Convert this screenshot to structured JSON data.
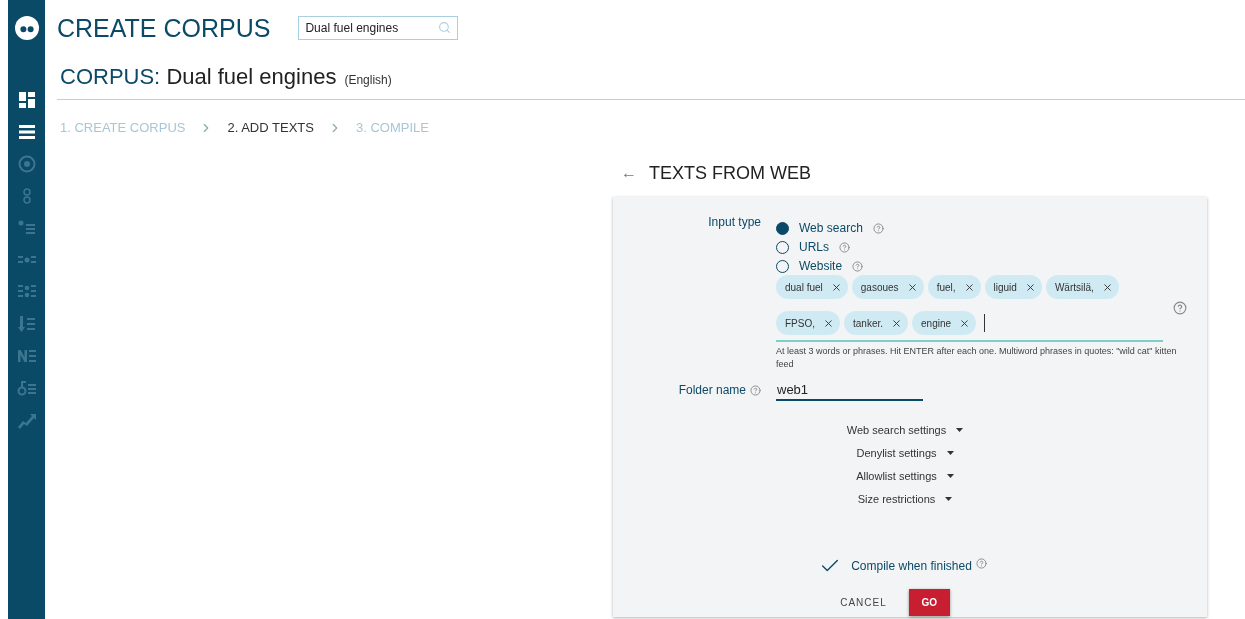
{
  "sidebar": {
    "items": [
      {
        "kind": "logo",
        "disabled": false
      },
      {
        "kind": "dashboard",
        "disabled": false
      },
      {
        "kind": "list",
        "disabled": false
      },
      {
        "kind": "target",
        "disabled": true
      },
      {
        "kind": "rings",
        "disabled": true
      },
      {
        "kind": "bullet-list",
        "disabled": true
      },
      {
        "kind": "dots-grid",
        "disabled": true
      },
      {
        "kind": "dots-grid-2",
        "disabled": true
      },
      {
        "kind": "sort-list",
        "disabled": true
      },
      {
        "kind": "ne-list",
        "disabled": true
      },
      {
        "kind": "key-list",
        "disabled": true
      },
      {
        "kind": "trend",
        "disabled": true
      }
    ]
  },
  "header": {
    "title": "CREATE CORPUS",
    "search": {
      "value": "Dual fuel engines"
    }
  },
  "corpus": {
    "label": "CORPUS:",
    "name": "Dual fuel engines",
    "language": "(English)"
  },
  "steps": [
    {
      "label": "1. CREATE CORPUS",
      "selected": false
    },
    {
      "label": "2. ADD TEXTS",
      "selected": true
    },
    {
      "label": "3. COMPILE",
      "selected": false
    }
  ],
  "panel": {
    "back": "←",
    "title": "TEXTS FROM WEB",
    "input_type": {
      "label": "Input type",
      "options": [
        {
          "label": "Web search",
          "selected": true
        },
        {
          "label": "URLs",
          "selected": false
        },
        {
          "label": "Website",
          "selected": false
        }
      ]
    },
    "tags": [
      "dual fuel",
      "gasoues",
      "fuel,",
      "liguid",
      "Wärtsilä,",
      "FPSO,",
      "tanker.",
      "engine"
    ],
    "tags_hint": "At least 3 words or phrases. Hit ENTER after each one. Multiword phrases in quotes: \"wild cat\" kitten feed",
    "folder": {
      "label": "Folder name",
      "value": "web1"
    },
    "settings": [
      "Web search settings",
      "Denylist settings",
      "Allowlist settings",
      "Size restrictions"
    ],
    "compile": {
      "label": "Compile when finished",
      "checked": true
    },
    "buttons": {
      "cancel": "CANCEL",
      "go": "GO"
    }
  }
}
